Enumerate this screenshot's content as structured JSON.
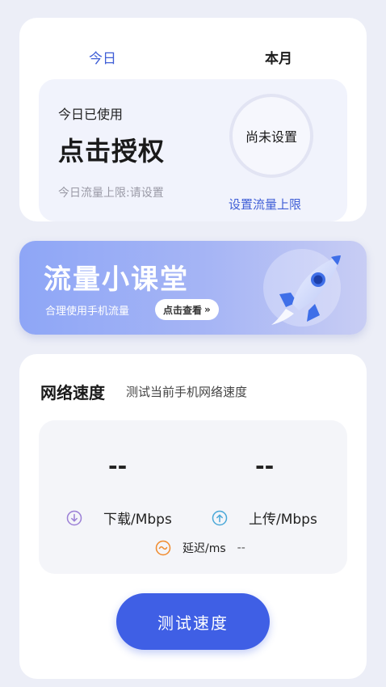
{
  "traffic": {
    "tabs": [
      {
        "label": "今日"
      },
      {
        "label": "本月"
      }
    ],
    "usage_label": "今日已使用",
    "auth_label": "点击授权",
    "limit_text": "今日流量上限:请设置",
    "ring_text": "尚未设置",
    "set_limit_link": "设置流量上限"
  },
  "banner": {
    "title": "流量小课堂",
    "subtitle": "合理使用手机流量",
    "button_label": "点击查看",
    "button_icon": "double-chevron-right"
  },
  "speed": {
    "title": "网络速度",
    "subtitle": "测试当前手机网络速度",
    "download_value": "--",
    "upload_value": "--",
    "download_label": "下载/Mbps",
    "upload_label": "上传/Mbps",
    "latency_label": "延迟/ms",
    "latency_value": "--",
    "test_button": "测试速度"
  },
  "colors": {
    "accent": "#3f5fe5",
    "link": "#3f5ed6",
    "download_icon": "#9b7fd6",
    "upload_icon": "#4aa8d8",
    "latency_icon": "#f08a2c"
  }
}
